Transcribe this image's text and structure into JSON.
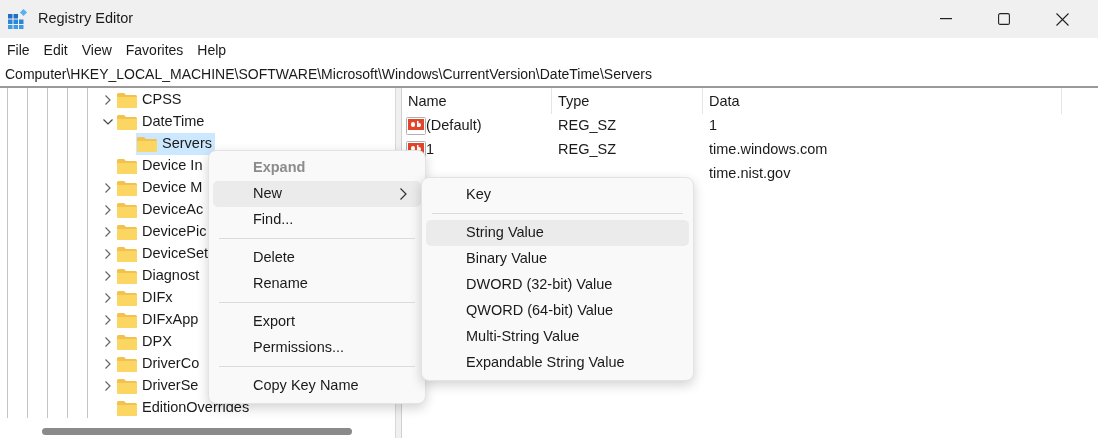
{
  "window": {
    "title": "Registry Editor"
  },
  "menu_bar": [
    "File",
    "Edit",
    "View",
    "Favorites",
    "Help"
  ],
  "address_bar": {
    "value": "Computer\\HKEY_LOCAL_MACHINE\\SOFTWARE\\Microsoft\\Windows\\CurrentVersion\\DateTime\\Servers"
  },
  "tree": [
    {
      "label": "CPSS",
      "expanded": false,
      "selected": false
    },
    {
      "label": "DateTime",
      "expanded": true,
      "selected": false,
      "children": [
        {
          "label": "Servers",
          "selected": true
        }
      ]
    },
    {
      "label": "Device In",
      "selected": false
    },
    {
      "label": "Device M",
      "expanded": false,
      "selected": false
    },
    {
      "label": "DeviceAc",
      "expanded": false,
      "selected": false
    },
    {
      "label": "DevicePic",
      "expanded": false,
      "selected": false
    },
    {
      "label": "DeviceSet",
      "expanded": false,
      "selected": false
    },
    {
      "label": "Diagnost",
      "expanded": false,
      "selected": false
    },
    {
      "label": "DIFx",
      "expanded": false,
      "selected": false
    },
    {
      "label": "DIFxApp",
      "expanded": false,
      "selected": false
    },
    {
      "label": "DPX",
      "expanded": false,
      "selected": false
    },
    {
      "label": "DriverCo",
      "expanded": false,
      "selected": false
    },
    {
      "label": "DriverSe",
      "expanded": false,
      "selected": false
    },
    {
      "label": "EditionOverrides",
      "selected": false
    }
  ],
  "values_list": {
    "columns": [
      "Name",
      "Type",
      "Data"
    ],
    "rows": [
      {
        "name": "(Default)",
        "type": "REG_SZ",
        "data": "1"
      },
      {
        "name": "1",
        "type": "REG_SZ",
        "data": "time.windows.com"
      },
      {
        "data": "time.nist.gov"
      }
    ]
  },
  "context_menu": [
    {
      "kind": "item",
      "label": "Expand",
      "disabled": true,
      "selected": false
    },
    {
      "kind": "item",
      "label": "New",
      "disabled": false,
      "selected": true,
      "submenu": true
    },
    {
      "kind": "item",
      "label": "Find...",
      "disabled": false,
      "selected": false
    },
    {
      "kind": "separator"
    },
    {
      "kind": "item",
      "label": "Delete",
      "disabled": false,
      "selected": false
    },
    {
      "kind": "item",
      "label": "Rename",
      "disabled": false,
      "selected": false
    },
    {
      "kind": "separator"
    },
    {
      "kind": "item",
      "label": "Export",
      "disabled": false,
      "selected": false
    },
    {
      "kind": "item",
      "label": "Permissions...",
      "disabled": false,
      "selected": false
    },
    {
      "kind": "separator"
    },
    {
      "kind": "item",
      "label": "Copy Key Name",
      "disabled": false,
      "selected": false
    }
  ],
  "submenu": [
    {
      "kind": "item",
      "label": "Key",
      "selected": false
    },
    {
      "kind": "separator"
    },
    {
      "kind": "item",
      "label": "String Value",
      "selected": true
    },
    {
      "kind": "item",
      "label": "Binary Value",
      "selected": false
    },
    {
      "kind": "item",
      "label": "DWORD (32-bit) Value",
      "selected": false
    },
    {
      "kind": "item",
      "label": "QWORD (64-bit) Value",
      "selected": false
    },
    {
      "kind": "item",
      "label": "Multi-String Value",
      "selected": false
    },
    {
      "kind": "item",
      "label": "Expandable String Value",
      "selected": false
    }
  ]
}
